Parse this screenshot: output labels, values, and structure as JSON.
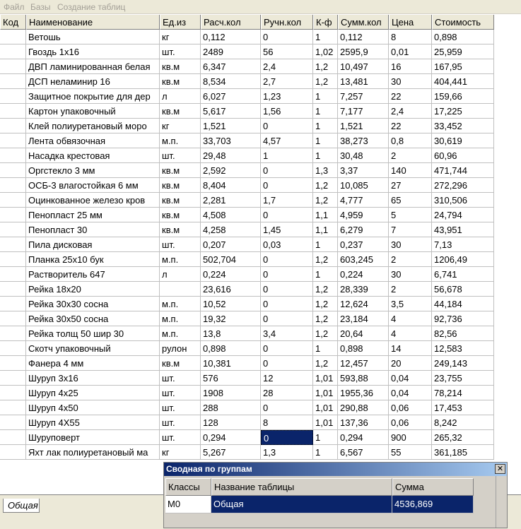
{
  "menu": [
    "Файл",
    "Базы",
    "Создание таблиц"
  ],
  "columns": [
    "Код",
    "Наименование",
    "Ед.из",
    "Расч.кол",
    "Ручн.кол",
    "К-ф",
    "Сумм.кол",
    "Цена",
    "Стоимость"
  ],
  "rows": [
    [
      "",
      "Ветошь",
      "кг",
      "0,112",
      "0",
      "1",
      "0,112",
      "8",
      "0,898"
    ],
    [
      "",
      "Гвоздь 1х16",
      "шт.",
      "2489",
      "56",
      "1,02",
      "2595,9",
      "0,01",
      "25,959"
    ],
    [
      "",
      "ДВП ламинированная белая",
      "кв.м",
      "6,347",
      "2,4",
      "1,2",
      "10,497",
      "16",
      "167,95"
    ],
    [
      "",
      "ДСП неламинир 16",
      "кв.м",
      "8,534",
      "2,7",
      "1,2",
      "13,481",
      "30",
      "404,441"
    ],
    [
      "",
      "Защитное покрытие для дер",
      "л",
      "6,027",
      "1,23",
      "1",
      "7,257",
      "22",
      "159,66"
    ],
    [
      "",
      "Картон упаковочный",
      "кв.м",
      "5,617",
      "1,56",
      "1",
      "7,177",
      "2,4",
      "17,225"
    ],
    [
      "",
      "Клей полиуретановый моро",
      "кг",
      "1,521",
      "0",
      "1",
      "1,521",
      "22",
      "33,452"
    ],
    [
      "",
      "Лента обвязочная",
      "м.п.",
      "33,703",
      "4,57",
      "1",
      "38,273",
      "0,8",
      "30,619"
    ],
    [
      "",
      "Насадка крестовая",
      "шт.",
      "29,48",
      "1",
      "1",
      "30,48",
      "2",
      "60,96"
    ],
    [
      "",
      "Оргстекло 3 мм",
      "кв.м",
      "2,592",
      "0",
      "1,3",
      "3,37",
      "140",
      "471,744"
    ],
    [
      "",
      "ОСБ-3 влагостойкая 6 мм",
      "кв.м",
      "8,404",
      "0",
      "1,2",
      "10,085",
      "27",
      "272,296"
    ],
    [
      "",
      "Оцинкованное железо кров",
      "кв.м",
      "2,281",
      "1,7",
      "1,2",
      "4,777",
      "65",
      "310,506"
    ],
    [
      "",
      "Пенопласт 25 мм",
      "кв.м",
      "4,508",
      "0",
      "1,1",
      "4,959",
      "5",
      "24,794"
    ],
    [
      "",
      "Пенопласт 30",
      "кв.м",
      "4,258",
      "1,45",
      "1,1",
      "6,279",
      "7",
      "43,951"
    ],
    [
      "",
      "Пила дисковая",
      "шт.",
      "0,207",
      "0,03",
      "1",
      "0,237",
      "30",
      "7,13"
    ],
    [
      "",
      "Планка 25х10 бук",
      "м.п.",
      "502,704",
      "0",
      "1,2",
      "603,245",
      "2",
      "1206,49"
    ],
    [
      "",
      "Растворитель 647",
      "л",
      "0,224",
      "0",
      "1",
      "0,224",
      "30",
      "6,741"
    ],
    [
      "",
      "Рейка 18х20",
      "",
      "23,616",
      "0",
      "1,2",
      "28,339",
      "2",
      "56,678"
    ],
    [
      "",
      "Рейка 30х30 сосна",
      "м.п.",
      "10,52",
      "0",
      "1,2",
      "12,624",
      "3,5",
      "44,184"
    ],
    [
      "",
      "Рейка 30х50 сосна",
      "м.п.",
      "19,32",
      "0",
      "1,2",
      "23,184",
      "4",
      "92,736"
    ],
    [
      "",
      "Рейка толщ 50 шир 30",
      "м.п.",
      "13,8",
      "3,4",
      "1,2",
      "20,64",
      "4",
      "82,56"
    ],
    [
      "",
      "Скотч упаковочный",
      "рулон",
      "0,898",
      "0",
      "1",
      "0,898",
      "14",
      "12,583"
    ],
    [
      "",
      "Фанера 4 мм",
      "кв.м",
      "10,381",
      "0",
      "1,2",
      "12,457",
      "20",
      "249,143"
    ],
    [
      "",
      "Шуруп 3х16",
      "шт.",
      "576",
      "12",
      "1,01",
      "593,88",
      "0,04",
      "23,755"
    ],
    [
      "",
      "Шуруп 4х25",
      "шт.",
      "1908",
      "28",
      "1,01",
      "1955,36",
      "0,04",
      "78,214"
    ],
    [
      "",
      "Шуруп 4х50",
      "шт.",
      "288",
      "0",
      "1,01",
      "290,88",
      "0,06",
      "17,453"
    ],
    [
      "",
      "Шуруп 4Х55",
      "шт.",
      "128",
      "8",
      "1,01",
      "137,36",
      "0,06",
      "8,242"
    ],
    [
      "",
      "Шуруповерт",
      "шт.",
      "0,294",
      "0",
      "1",
      "0,294",
      "900",
      "265,32"
    ],
    [
      "",
      "Яхт лак полиуретановый ма",
      "кг",
      "5,267",
      "1,3",
      "1",
      "6,567",
      "55",
      "361,185"
    ]
  ],
  "selected_cell": {
    "row": 27,
    "col": 4
  },
  "tab_label": "Общая",
  "summary": {
    "title": "Сводная  по группам",
    "close_glyph": "✕",
    "columns": [
      "Классы",
      "Название таблицы",
      "Сумма"
    ],
    "rows": [
      [
        "М0",
        "Общая",
        "4536,869"
      ]
    ]
  },
  "colors": {
    "selection": "#0a246a",
    "chrome": "#ece9d8"
  }
}
